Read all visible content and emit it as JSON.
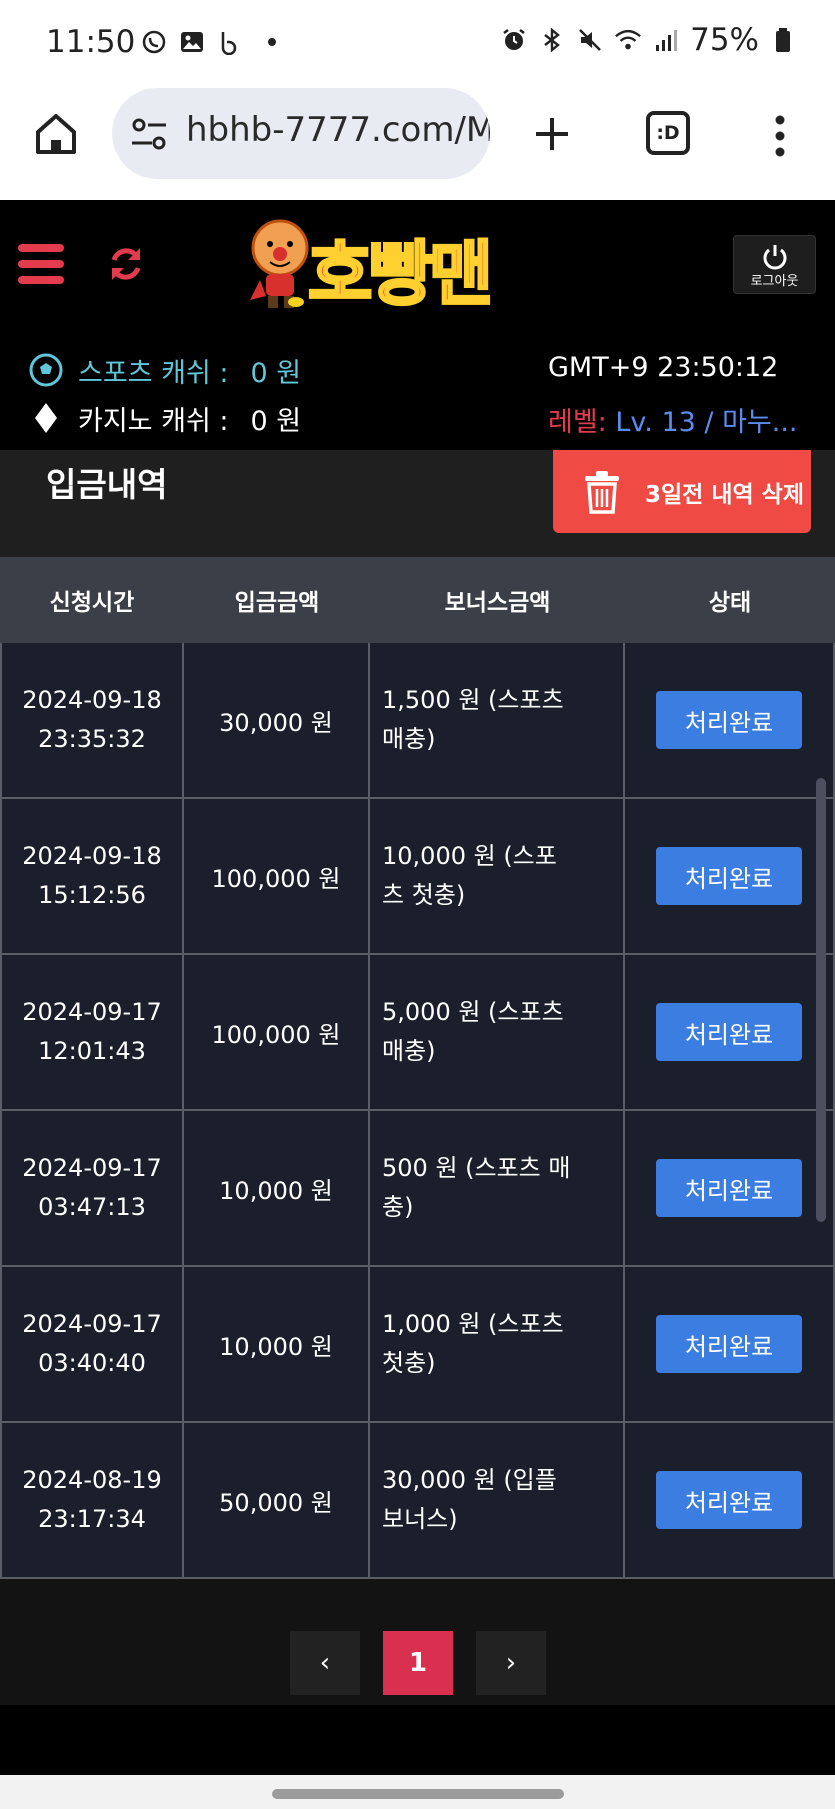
{
  "status_bar": {
    "time": "11:50",
    "battery": "75%",
    "icons_left": [
      "whatsapp-icon",
      "gallery-icon",
      "app-b-icon",
      "dot-icon"
    ],
    "icons_right": [
      "alarm-icon",
      "bluetooth-icon",
      "mute-icon",
      "wifi-icon",
      "signal-icon",
      "battery-icon"
    ]
  },
  "browser": {
    "url": "hbhb-7777.com/M",
    "tabs_label": ":D"
  },
  "header": {
    "logo_text": "호빵맨",
    "logout_label": "로그아웃",
    "sports_cash_label": "스포츠 캐쉬 :",
    "sports_cash_value": "0 원",
    "casino_cash_label": "카지노 캐쉬 :",
    "casino_cash_value": "0 원",
    "clock": "GMT+9 23:50:12",
    "level_label": "레벨: ",
    "level_value": "Lv. 13 / 마누..."
  },
  "panel": {
    "title": "입금내역",
    "delete_label": "3일전 내역 삭제"
  },
  "table": {
    "headers": [
      "신청시간",
      "입금금액",
      "보너스금액",
      "상태"
    ],
    "rows": [
      {
        "time": "2024-09-18\n23:35:32",
        "amount": "30,000 원",
        "bonus": "1,500 원 (스포츠 매충)",
        "status": "처리완료"
      },
      {
        "time": "2024-09-18\n15:12:56",
        "amount": "100,000 원",
        "bonus": "10,000 원 (스포츠 첫충)",
        "status": "처리완료"
      },
      {
        "time": "2024-09-17\n12:01:43",
        "amount": "100,000 원",
        "bonus": "5,000 원 (스포츠 매충)",
        "status": "처리완료"
      },
      {
        "time": "2024-09-17\n03:47:13",
        "amount": "10,000 원",
        "bonus": "500 원 (스포츠 매충)",
        "status": "처리완료"
      },
      {
        "time": "2024-09-17\n03:40:40",
        "amount": "10,000 원",
        "bonus": "1,000 원 (스포츠 첫충)",
        "status": "처리완료"
      },
      {
        "time": "2024-08-19\n23:17:34",
        "amount": "50,000 원",
        "bonus": "30,000 원 (입플 보너스)",
        "status": "처리완료"
      }
    ]
  },
  "pagination": {
    "prev": "‹",
    "current": "1",
    "next": "›"
  },
  "colors": {
    "accent_red": "#d8304e",
    "status_blue": "#3b7de0",
    "delete_red": "#ef4a43",
    "sport_cyan": "#5fc7d8",
    "level_blue": "#5b8cf0"
  }
}
